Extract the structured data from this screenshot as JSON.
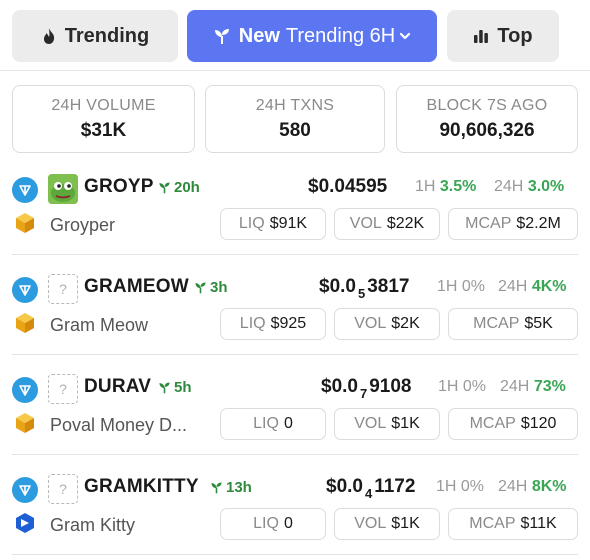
{
  "tabs": {
    "trending": "Trending",
    "new": "New",
    "new_sub": "Trending 6H",
    "top": "Top"
  },
  "stats": [
    {
      "label": "24H VOLUME",
      "value": "$31K"
    },
    {
      "label": "24H TXNS",
      "value": "580"
    },
    {
      "label": "BLOCK 7S AGO",
      "value": "90,606,326"
    }
  ],
  "rows": [
    {
      "ticker": "GROYP",
      "age": "20h",
      "name": "Groyper",
      "price_prefix": "$0.04595",
      "price_zeros": "",
      "price_tail": "",
      "h1_label": "1H",
      "h1": "3.5%",
      "h24_label": "24H",
      "h24": "3.0%",
      "liq_label": "LIQ",
      "liq": "$91K",
      "vol_label": "VOL",
      "vol": "$22K",
      "mcap_label": "MCAP",
      "mcap": "$2.2M"
    },
    {
      "ticker": "GRAMEOW",
      "age": "3h",
      "name": "Gram Meow",
      "price_prefix": "$0.0",
      "price_zeros": "5",
      "price_tail": "3817",
      "h1_label": "1H",
      "h1": "0%",
      "h24_label": "24H",
      "h24": "4K%",
      "liq_label": "LIQ",
      "liq": "$925",
      "vol_label": "VOL",
      "vol": "$2K",
      "mcap_label": "MCAP",
      "mcap": "$5K"
    },
    {
      "ticker": "DURAV",
      "age": "5h",
      "name": "Poval Money D...",
      "price_prefix": "$0.0",
      "price_zeros": "7",
      "price_tail": "9108",
      "h1_label": "1H",
      "h1": "0%",
      "h24_label": "24H",
      "h24": "73%",
      "liq_label": "LIQ",
      "liq": "0",
      "vol_label": "VOL",
      "vol": "$1K",
      "mcap_label": "MCAP",
      "mcap": "$120"
    },
    {
      "ticker": "GRAMKITTY",
      "age": "13h",
      "name": "Gram Kitty",
      "price_prefix": "$0.0",
      "price_zeros": "4",
      "price_tail": "1172",
      "h1_label": "1H",
      "h1": "0%",
      "h24_label": "24H",
      "h24": "8K%",
      "liq_label": "LIQ",
      "liq": "0",
      "vol_label": "VOL",
      "vol": "$1K",
      "mcap_label": "MCAP",
      "mcap": "$11K"
    }
  ],
  "colors": {
    "accent": "#5b76f0",
    "positive": "#3aa655",
    "chain": "#2d9be0"
  }
}
